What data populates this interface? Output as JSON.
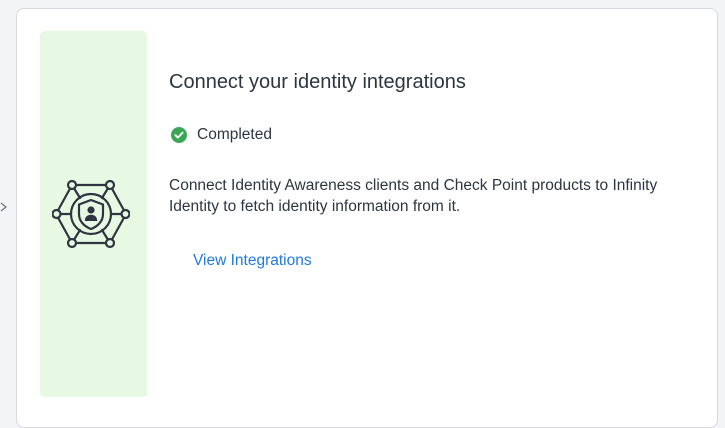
{
  "card": {
    "title": "Connect your identity integrations",
    "status": {
      "label": "Completed",
      "icon": "check-circle-icon",
      "color": "#3aa757"
    },
    "description": "Connect Identity Awareness clients and Check Point products to Infinity Identity to fetch identity information from it.",
    "link_label": "View Integrations",
    "illustration_icon": "identity-network-icon",
    "panel_color": "#e8f9e3",
    "link_color": "#1f7ae0"
  }
}
